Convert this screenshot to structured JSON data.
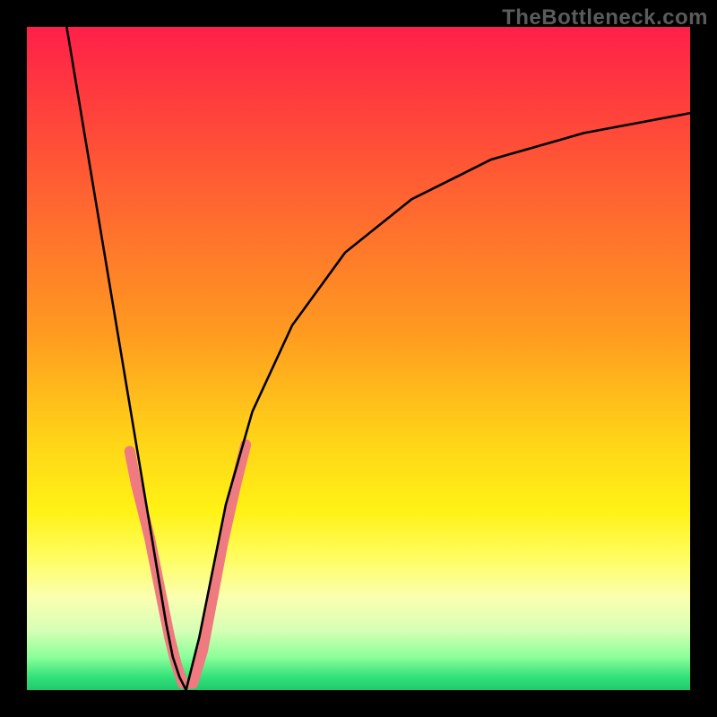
{
  "watermark": "TheBottleneck.com",
  "chart_data": {
    "type": "line",
    "title": "",
    "xlabel": "",
    "ylabel": "",
    "xlim": [
      0,
      100
    ],
    "ylim": [
      0,
      100
    ],
    "gradient_stops": [
      {
        "pct": 0,
        "color": "#ff1f4a"
      },
      {
        "pct": 10,
        "color": "#ff3a3e"
      },
      {
        "pct": 22,
        "color": "#ff5a34"
      },
      {
        "pct": 34,
        "color": "#ff7a2a"
      },
      {
        "pct": 46,
        "color": "#ff9a20"
      },
      {
        "pct": 62,
        "color": "#ffd318"
      },
      {
        "pct": 73,
        "color": "#fff215"
      },
      {
        "pct": 80,
        "color": "#fffd60"
      },
      {
        "pct": 86,
        "color": "#fbffb0"
      },
      {
        "pct": 91,
        "color": "#d6ffb5"
      },
      {
        "pct": 95,
        "color": "#8cff9a"
      },
      {
        "pct": 98,
        "color": "#33e27a"
      },
      {
        "pct": 100,
        "color": "#1fc96d"
      }
    ],
    "series": [
      {
        "name": "bottleneck-curve-left",
        "stroke": "#000000",
        "x": [
          6,
          8,
          10,
          12,
          14,
          16,
          18,
          20,
          21,
          22,
          23,
          24
        ],
        "y": [
          100,
          88,
          76,
          64,
          52,
          40,
          28,
          16,
          10,
          5,
          2,
          0
        ]
      },
      {
        "name": "bottleneck-curve-right",
        "stroke": "#000000",
        "x": [
          24,
          26,
          28,
          30,
          34,
          40,
          48,
          58,
          70,
          84,
          100
        ],
        "y": [
          0,
          8,
          18,
          28,
          42,
          55,
          66,
          74,
          80,
          84,
          87
        ]
      }
    ],
    "highlight_segments": {
      "name": "observed-range-markers",
      "color": "#ef7a7f",
      "stroke_width": 12,
      "segments": [
        {
          "x": [
            15.5,
            16.5
          ],
          "y": [
            36,
            31
          ]
        },
        {
          "x": [
            16.5,
            18.5
          ],
          "y": [
            31,
            23
          ]
        },
        {
          "x": [
            18.5,
            20.5
          ],
          "y": [
            23,
            13
          ]
        },
        {
          "x": [
            20.5,
            21.5
          ],
          "y": [
            13,
            8
          ]
        },
        {
          "x": [
            21.5,
            22.5
          ],
          "y": [
            8,
            4
          ]
        },
        {
          "x": [
            22.5,
            23.5
          ],
          "y": [
            4,
            1
          ]
        },
        {
          "x": [
            23.5,
            25.0
          ],
          "y": [
            1,
            1
          ]
        },
        {
          "x": [
            25.0,
            26.5
          ],
          "y": [
            1,
            6
          ]
        },
        {
          "x": [
            26.5,
            28.0
          ],
          "y": [
            6,
            14
          ]
        },
        {
          "x": [
            28.0,
            29.5
          ],
          "y": [
            14,
            22
          ]
        },
        {
          "x": [
            29.5,
            31.5
          ],
          "y": [
            22,
            31
          ]
        },
        {
          "x": [
            31.5,
            33.0
          ],
          "y": [
            31,
            37
          ]
        }
      ]
    }
  }
}
